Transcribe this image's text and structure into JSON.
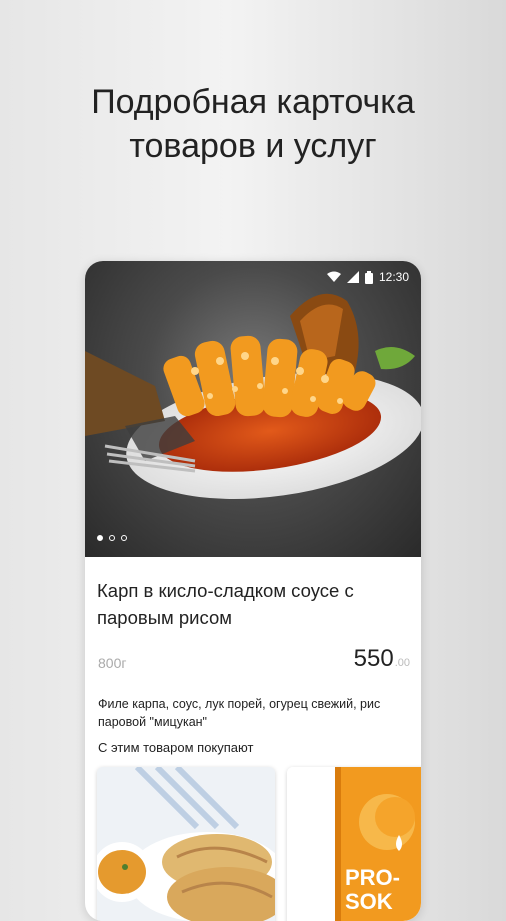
{
  "headline": {
    "line1": "Подробная карточка",
    "line2": "товаров и услуг"
  },
  "status_bar": {
    "time": "12:30",
    "icons": [
      "wifi-icon",
      "signal-icon",
      "battery-icon"
    ]
  },
  "gallery": {
    "image": "fish-dish-photo",
    "page_count": 3,
    "active_index": 0
  },
  "product": {
    "title": "Карп в кисло-сладком соусе с паровым рисом",
    "weight": "800г",
    "price": "550",
    "price_cents": ".00",
    "description": "Филе карпа, соус, лук порей, огурец свежий, рис паровой \"мицукан\""
  },
  "related": {
    "heading": "С этим товаром покупают",
    "items": [
      {
        "image": "flatbread-with-sauce-photo"
      },
      {
        "image": "juice-carton-photo",
        "brand_text": "PRO-SOK"
      }
    ]
  },
  "colors": {
    "accent_orange": "#f29a1f",
    "text_dark": "#222222",
    "text_muted": "#aaaaaa"
  }
}
